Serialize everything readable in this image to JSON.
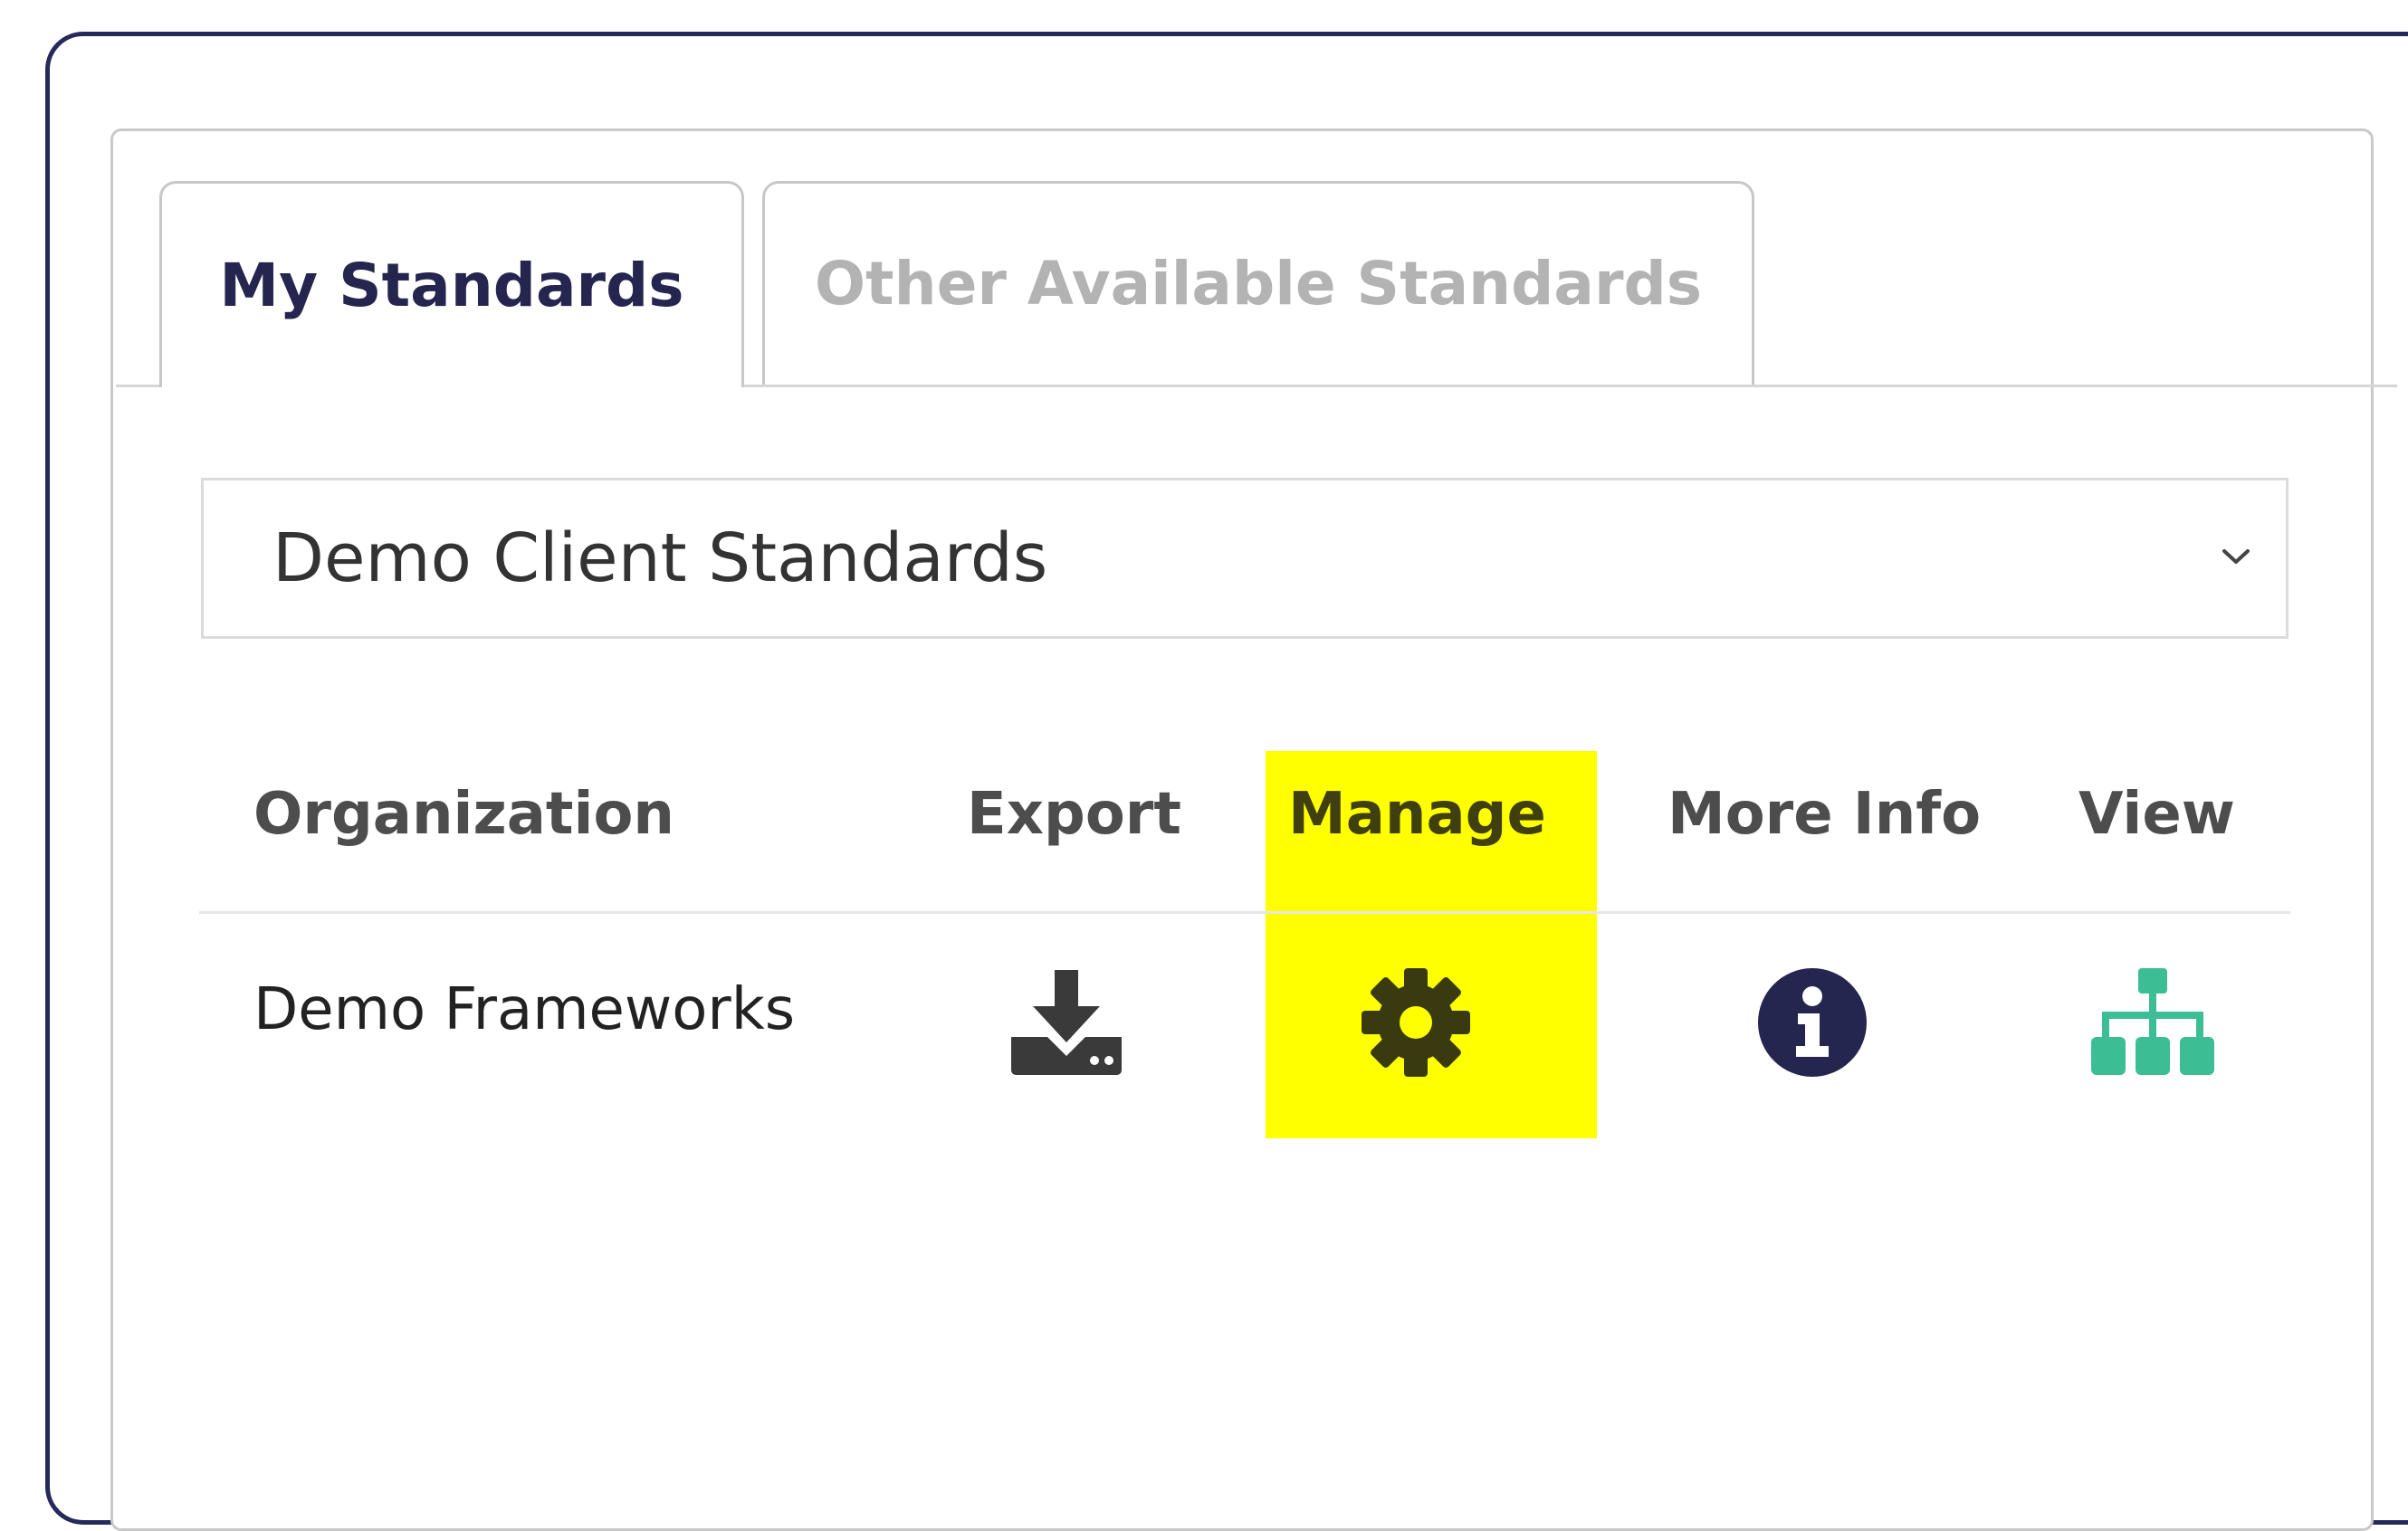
{
  "tabs": [
    {
      "label": "My Standards",
      "active": true
    },
    {
      "label": "Other Available Standards",
      "active": false
    }
  ],
  "standards_select": {
    "value": "Demo Client Standards"
  },
  "table": {
    "columns": [
      "Organization",
      "Export",
      "Manage",
      "More Info",
      "View"
    ],
    "rows": [
      {
        "organization": "Demo Frameworks",
        "export_icon": "download-icon",
        "manage_icon": "gear-icon",
        "more_info_icon": "info-circle-icon",
        "view_icon": "sitemap-icon"
      }
    ],
    "highlighted_column": "Manage"
  },
  "colors": {
    "frame_border": "#262a5a",
    "active_tab_text": "#24264f",
    "inactive_tab_text": "#b3b3b3",
    "highlight": "#ffff00",
    "export_icon": "#3a3a3a",
    "manage_icon": "#3a3a10",
    "info_icon": "#24264f",
    "view_icon": "#3dbd94"
  }
}
